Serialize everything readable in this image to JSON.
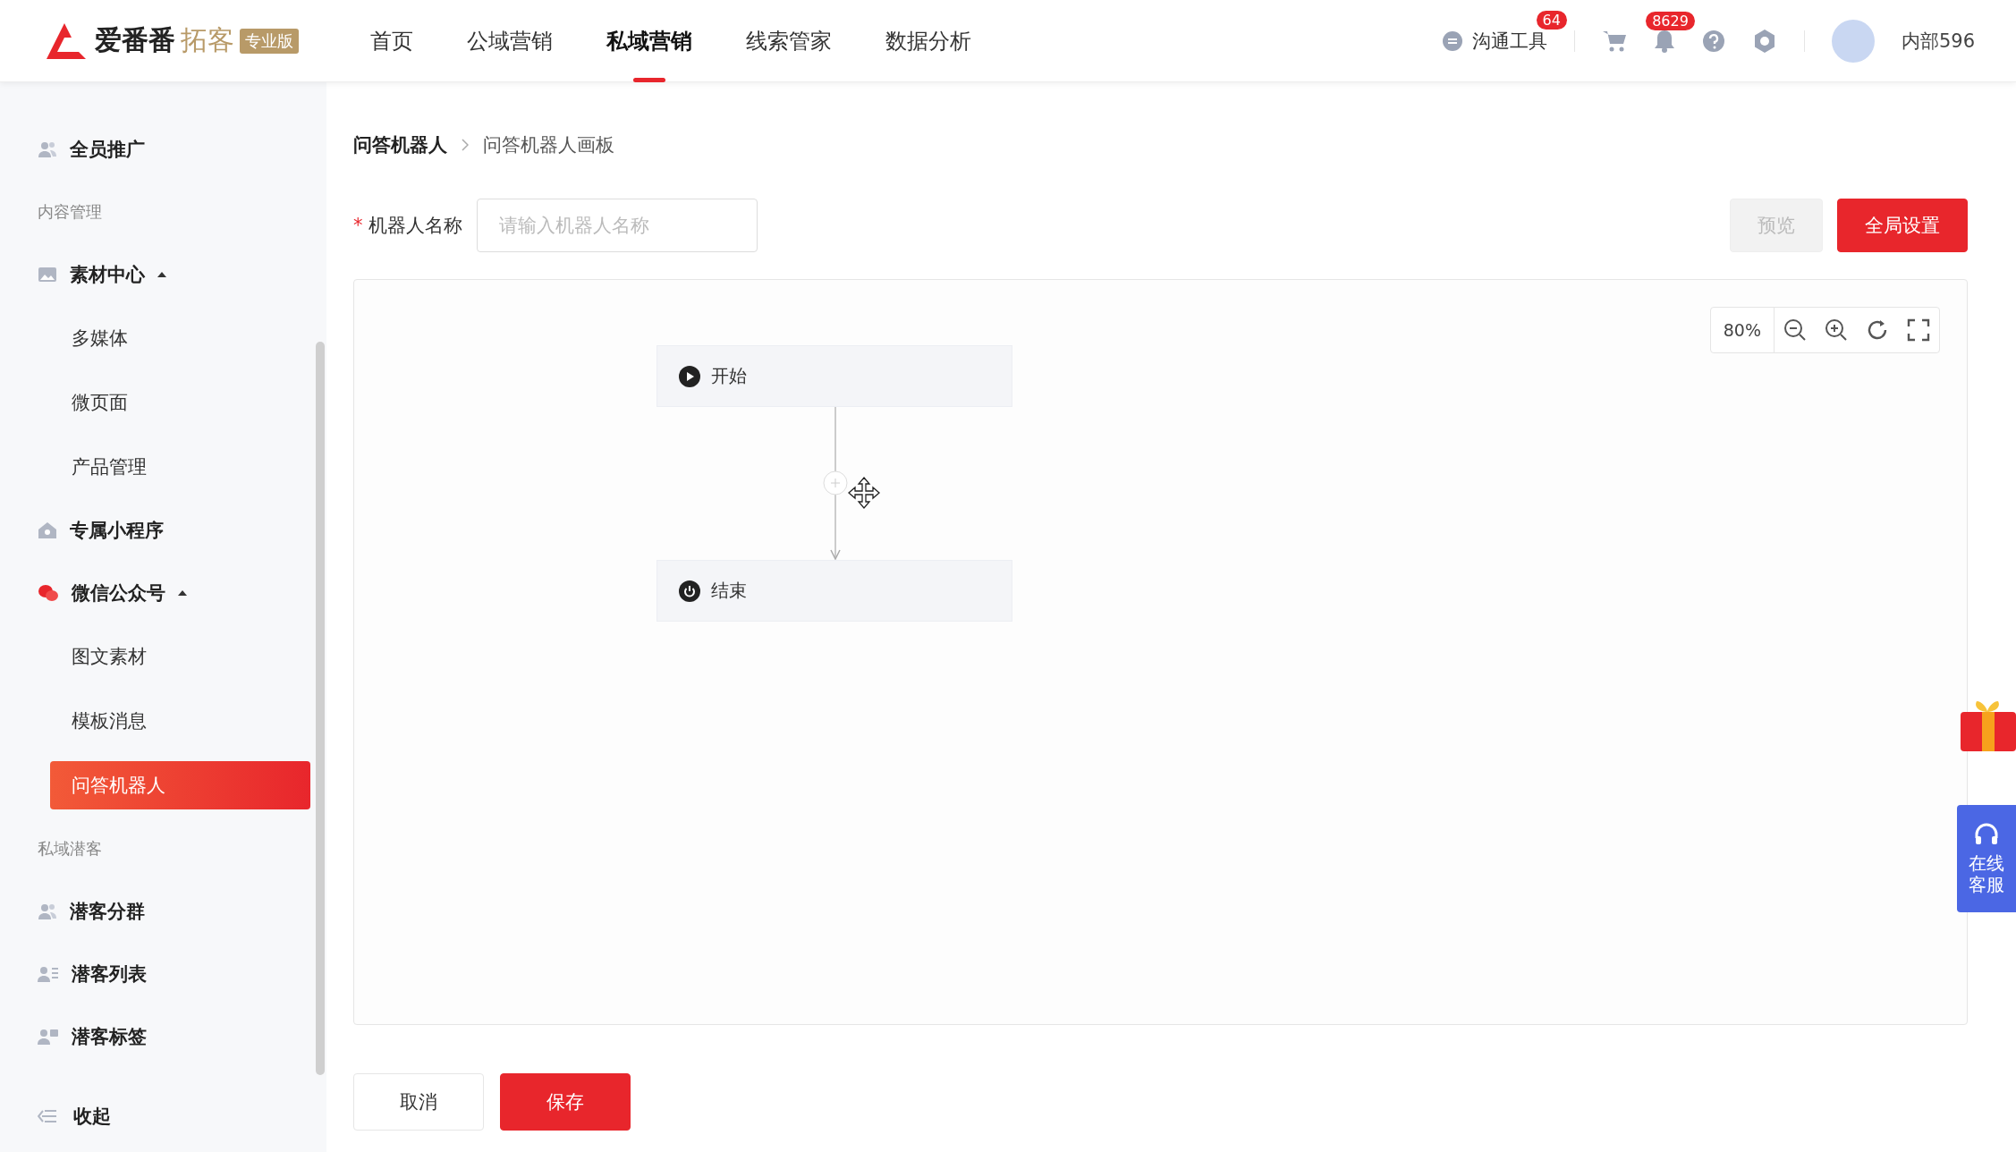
{
  "header": {
    "logo": {
      "name": "爱番番",
      "sub": "拓客",
      "edition": "专业版"
    },
    "nav": [
      {
        "label": "首页",
        "selected": false
      },
      {
        "label": "公域营销",
        "selected": false
      },
      {
        "label": "私域营销",
        "selected": true
      },
      {
        "label": "线索管家",
        "selected": false
      },
      {
        "label": "数据分析",
        "selected": false
      }
    ],
    "tools": {
      "label": "沟通工具",
      "badge": "64"
    },
    "notifications_badge": "8629",
    "user": "内部596"
  },
  "sidebar": {
    "items": [
      {
        "kind": "group",
        "label": "全员推广"
      },
      {
        "kind": "section",
        "label": "内容管理"
      },
      {
        "kind": "group",
        "label": "素材中心",
        "expanded": true,
        "children": [
          {
            "label": "多媒体",
            "selected": false
          },
          {
            "label": "微页面",
            "selected": false
          },
          {
            "label": "产品管理",
            "selected": false
          }
        ]
      },
      {
        "kind": "group",
        "label": "专属小程序"
      },
      {
        "kind": "group",
        "label": "微信公众号",
        "expanded": true,
        "children": [
          {
            "label": "图文素材",
            "selected": false
          },
          {
            "label": "模板消息",
            "selected": false
          },
          {
            "label": "问答机器人",
            "selected": true
          }
        ]
      },
      {
        "kind": "section",
        "label": "私域潜客"
      },
      {
        "kind": "group",
        "label": "潜客分群"
      },
      {
        "kind": "group",
        "label": "潜客列表"
      },
      {
        "kind": "group",
        "label": "潜客标签"
      }
    ],
    "collapse": "收起"
  },
  "breadcrumb": [
    "问答机器人",
    "问答机器人画板"
  ],
  "form": {
    "required_mark": "*",
    "label": "机器人名称",
    "placeholder": "请输入机器人名称",
    "preview": "预览",
    "settings": "全局设置"
  },
  "canvas": {
    "zoom": "80%",
    "nodes": [
      {
        "kind": "start",
        "label": "开始"
      },
      {
        "kind": "end",
        "label": "结束"
      }
    ]
  },
  "actions": {
    "cancel": "取消",
    "save": "保存"
  },
  "service": "在线客服"
}
